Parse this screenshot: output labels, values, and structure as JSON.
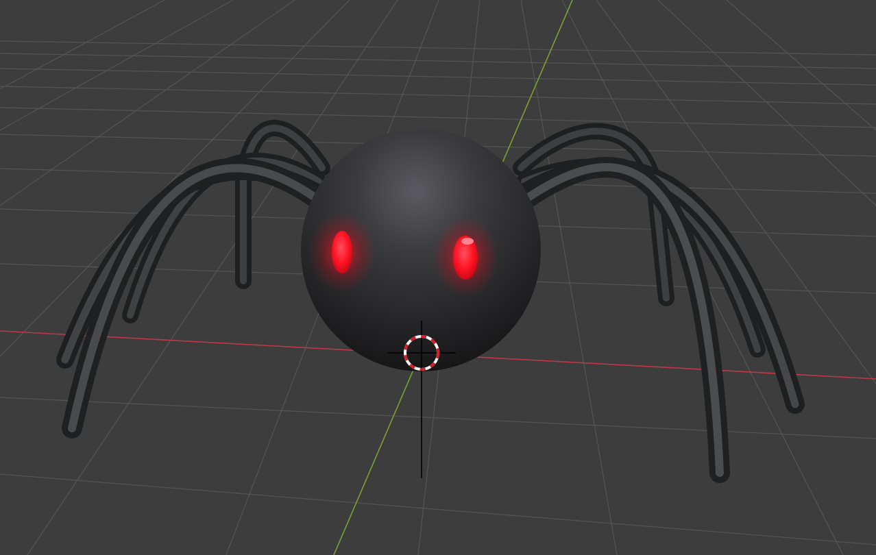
{
  "viewport": {
    "background_color": "#3d3d3d",
    "grid_line_color": "#555555",
    "x_axis_color": "#c0384a",
    "y_axis_color": "#7ba232"
  },
  "scene_objects": {
    "spider_body_color": "#2a2a2c",
    "spider_leg_color": "#2e2f31",
    "eye_color": "#ff1a24",
    "eye_glow_color": "#ff0010"
  },
  "cursor": {
    "name": "3d-cursor-icon",
    "ring_colors": [
      "#ffffff",
      "#d0202a"
    ]
  }
}
